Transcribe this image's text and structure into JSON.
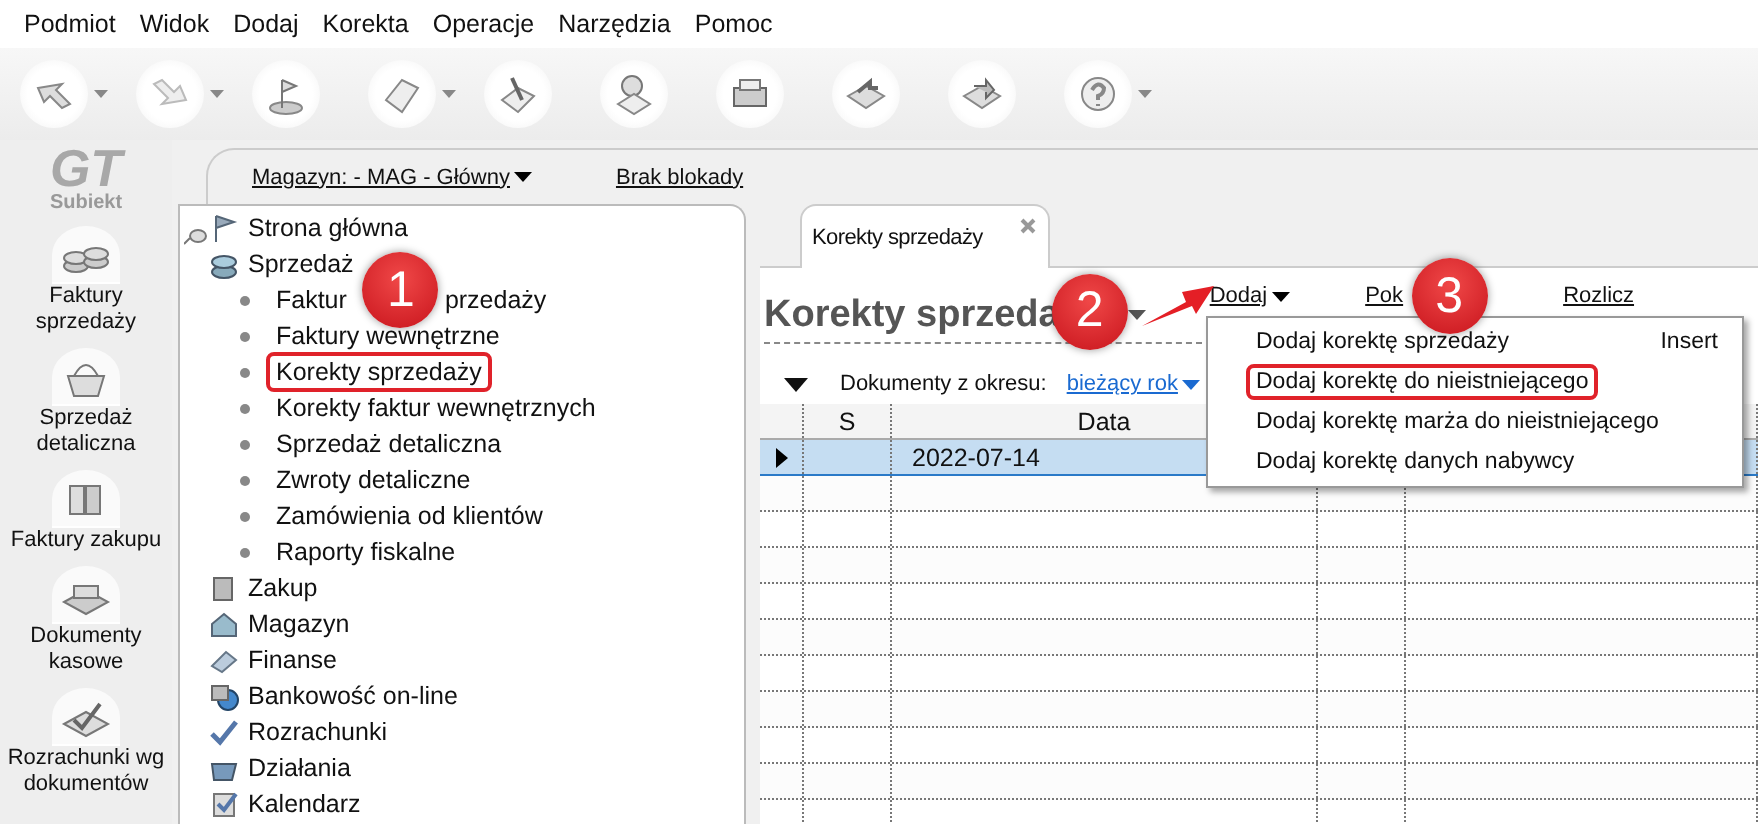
{
  "menu_bar": [
    "Podmiot",
    "Widok",
    "Dodaj",
    "Korekta",
    "Operacje",
    "Narzędzia",
    "Pomoc"
  ],
  "logo": {
    "mark": "GT",
    "name": "Subiekt"
  },
  "nav": [
    "Faktury sprzedaży",
    "Sprzedaż detaliczna",
    "Faktury zakupu",
    "Dokumenty kasowe",
    "Rozrachunki wg dokumentów"
  ],
  "header": {
    "warehouse": "Magazyn: - MAG - Główny",
    "lock": "Brak blokady"
  },
  "tree": [
    {
      "label": "Strona główna"
    },
    {
      "label": "Sprzedaż",
      "children": [
        {
          "label": "Faktur",
          "label_after": "przedaży",
          "badge": "1",
          "outlined": false
        },
        {
          "label": "Faktury wewnętrzne",
          "outlined": false
        },
        {
          "label": "Korekty sprzedaży",
          "outlined": true
        },
        {
          "label": "Korekty faktur wewnętrznych",
          "outlined": false
        },
        {
          "label": "Sprzedaż detaliczna",
          "outlined": false
        },
        {
          "label": "Zwroty detaliczne",
          "outlined": false
        },
        {
          "label": "Zamówienia od klientów",
          "outlined": false
        },
        {
          "label": "Raporty fiskalne",
          "outlined": false
        }
      ]
    },
    {
      "label": "Zakup"
    },
    {
      "label": "Magazyn"
    },
    {
      "label": "Finanse"
    },
    {
      "label": "Bankowość on-line"
    },
    {
      "label": "Rozrachunki"
    },
    {
      "label": "Działania"
    },
    {
      "label": "Kalendarz"
    }
  ],
  "tabs": [
    {
      "label": "Korekty sprzedaży",
      "selected": true
    }
  ],
  "title": {
    "text": "Korekty sprzeda",
    "badge": "2"
  },
  "actions": [
    {
      "label": "Dodaj",
      "kind": "dropdown"
    },
    {
      "label": "Pok",
      "kind": "link",
      "badge": "3"
    },
    {
      "label": "Rozlicz",
      "kind": "link"
    }
  ],
  "filter": {
    "label": "Dokumenty z okresu:",
    "value": "bieżący rok"
  },
  "table": {
    "columns": [
      "S",
      "Data"
    ],
    "rows": [
      {
        "selected": true,
        "current": true,
        "date": "2022-07-14"
      }
    ]
  },
  "popup_menu": [
    {
      "label": "Dodaj korektę sprzedaży",
      "shortcut": "Insert",
      "outlined": false
    },
    {
      "label": "Dodaj korektę do nieistniejącego",
      "outlined": true
    },
    {
      "label": "Dodaj korektę marża do nieistniejącego",
      "outlined": false
    },
    {
      "label": "Dodaj korektę danych nabywcy",
      "outlined": false
    }
  ]
}
